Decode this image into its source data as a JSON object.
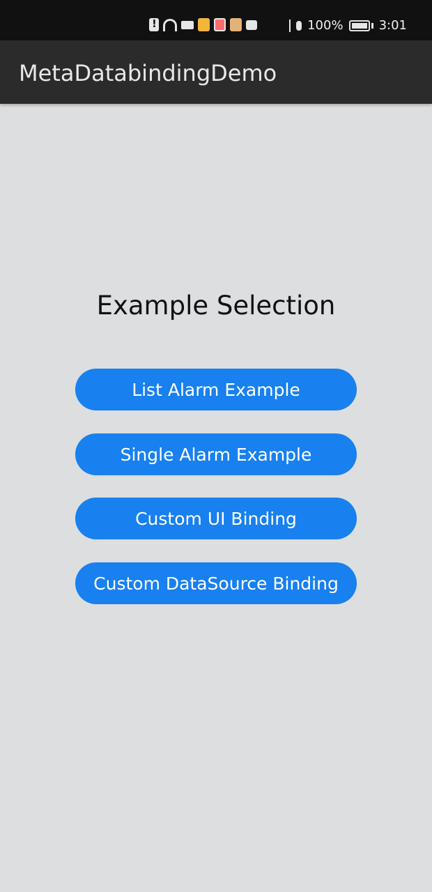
{
  "status_bar": {
    "battery": "100%",
    "time": "3:01",
    "icons": [
      "alert-icon",
      "wifi-icon",
      "video-icon",
      "weibo-icon",
      "book-icon",
      "app-icon",
      "nmb-icon",
      "bluetooth-icon",
      "microphone-icon",
      "battery-icon"
    ]
  },
  "app_bar": {
    "title": "MetaDatabindingDemo"
  },
  "main": {
    "heading": "Example Selection",
    "buttons": [
      {
        "label": "List Alarm Example"
      },
      {
        "label": "Single Alarm Example"
      },
      {
        "label": "Custom UI Binding"
      },
      {
        "label": "Custom DataSource Binding"
      }
    ]
  },
  "colors": {
    "button": "#1880ef",
    "background": "#dcdee0",
    "app_bar": "#2b2b2b",
    "status_bar": "#111111"
  }
}
